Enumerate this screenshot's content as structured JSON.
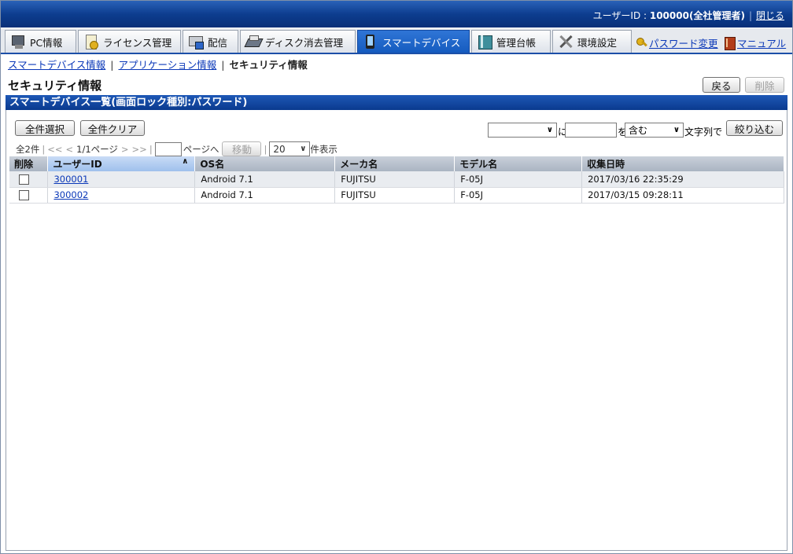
{
  "header": {
    "user_label": "ユーザーID : ",
    "user_value": "100000(全社管理者)",
    "close_link": "閉じる"
  },
  "tabs": [
    {
      "label": "PC情報",
      "icon": "pc-icon"
    },
    {
      "label": "ライセンス管理",
      "icon": "license-icon"
    },
    {
      "label": "配信",
      "icon": "distribution-icon"
    },
    {
      "label": "ディスク消去管理",
      "icon": "disk-erase-icon"
    },
    {
      "label": "スマートデバイス",
      "icon": "smartphone-icon",
      "active": true
    },
    {
      "label": "管理台帳",
      "icon": "ledger-icon"
    },
    {
      "label": "環境設定",
      "icon": "tools-icon"
    }
  ],
  "links": {
    "password_change": "パスワード変更",
    "manual": "マニュアル"
  },
  "subnav": {
    "item1": "スマートデバイス情報",
    "item2": "アプリケーション情報",
    "current": "セキュリティ情報"
  },
  "page": {
    "title": "セキュリティ情報",
    "back_button": "戻る",
    "delete_button": "削除"
  },
  "section": {
    "title": "スマートデバイス一覧(画面ロック種別:パスワード)"
  },
  "toolbar": {
    "select_all": "全件選択",
    "clear_all": "全件クリア",
    "filter_field": "",
    "filter_ni": "に",
    "filter_value": "",
    "filter_wo": "を",
    "filter_mode": "含む",
    "filter_suffix": "文字列で",
    "filter_button": "絞り込む"
  },
  "pager": {
    "total": "全2件",
    "first": "<<",
    "prev": "<",
    "page_info": "1/1ページ",
    "next": ">",
    "last": ">>",
    "page_input": "",
    "goto_label": "ページへ",
    "move_button": "移動",
    "per_page": "20",
    "per_page_label": "件表示"
  },
  "table": {
    "columns": [
      "削除",
      "ユーザーID",
      "OS名",
      "メーカ名",
      "モデル名",
      "収集日時"
    ],
    "rows": [
      {
        "user_id": "300001",
        "os": "Android 7.1",
        "maker": "FUJITSU",
        "model": "F-05J",
        "collected": "2017/03/16 22:35:29"
      },
      {
        "user_id": "300002",
        "os": "Android 7.1",
        "maker": "FUJITSU",
        "model": "F-05J",
        "collected": "2017/03/15 09:28:11"
      }
    ]
  },
  "colors": {
    "header_blue": "#0d3d8f",
    "active_tab": "#155bbf",
    "link": "#0b38b8"
  }
}
